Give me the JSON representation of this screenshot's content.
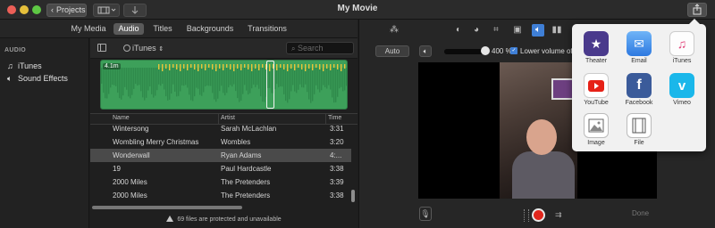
{
  "window": {
    "title": "My Movie",
    "projects_label": "Projects"
  },
  "media_tabs": [
    {
      "label": "My Media",
      "active": false
    },
    {
      "label": "Audio",
      "active": true
    },
    {
      "label": "Titles",
      "active": false
    },
    {
      "label": "Backgrounds",
      "active": false
    },
    {
      "label": "Transitions",
      "active": false
    }
  ],
  "sidebar": {
    "heading": "AUDIO",
    "items": [
      {
        "label": "iTunes",
        "icon": "music-note-icon"
      },
      {
        "label": "Sound Effects",
        "icon": "speaker-icon"
      }
    ]
  },
  "browser": {
    "source": "iTunes",
    "search_placeholder": "Search",
    "clip_duration": "4.1m",
    "columns": {
      "name": "Name",
      "artist": "Artist",
      "time": "Time"
    },
    "rows": [
      {
        "name": "Wintersong",
        "artist": "Sarah McLachlan",
        "time": "3:31",
        "selected": false
      },
      {
        "name": "Wombling Merry Christmas",
        "artist": "Wombles",
        "time": "3:20",
        "selected": false
      },
      {
        "name": "Wonderwall",
        "artist": "Ryan Adams",
        "time": "4:...",
        "selected": true
      },
      {
        "name": "19",
        "artist": "Paul Hardcastle",
        "time": "3:38",
        "selected": false
      },
      {
        "name": "2000 Miles",
        "artist": "The Pretenders",
        "time": "3:39",
        "selected": false
      },
      {
        "name": "2000 Miles",
        "artist": "The Pretenders",
        "time": "3:38",
        "selected": false
      }
    ],
    "status": "69 files are protected and unavailable"
  },
  "viewer": {
    "auto_label": "Auto",
    "volume_percent": "400 %",
    "volume_level": 1.0,
    "lower_volume_label": "Lower volume of o",
    "lower_volume_checked": true,
    "done_label": "Done"
  },
  "share_menu": {
    "items": [
      {
        "label": "Theater",
        "icon": "theater-icon",
        "color": "#4a3a8c"
      },
      {
        "label": "Email",
        "icon": "email-icon",
        "color": "#3d8ee8"
      },
      {
        "label": "iTunes",
        "icon": "itunes-icon",
        "color": "#f4f4f4"
      },
      {
        "label": "YouTube",
        "icon": "youtube-icon",
        "color": "#ffffff"
      },
      {
        "label": "Facebook",
        "icon": "facebook-icon",
        "color": "#3b5b9a"
      },
      {
        "label": "Vimeo",
        "icon": "vimeo-icon",
        "color": "#1ab7ea"
      },
      {
        "label": "Image",
        "icon": "image-icon",
        "color": "#ffffff"
      },
      {
        "label": "File",
        "icon": "file-icon",
        "color": "#ffffff"
      }
    ]
  },
  "colors": {
    "accent": "#3f7fd6",
    "waveform": "#3da05a",
    "waveform_peaks": "#e8c43a",
    "record": "#e0261c"
  }
}
